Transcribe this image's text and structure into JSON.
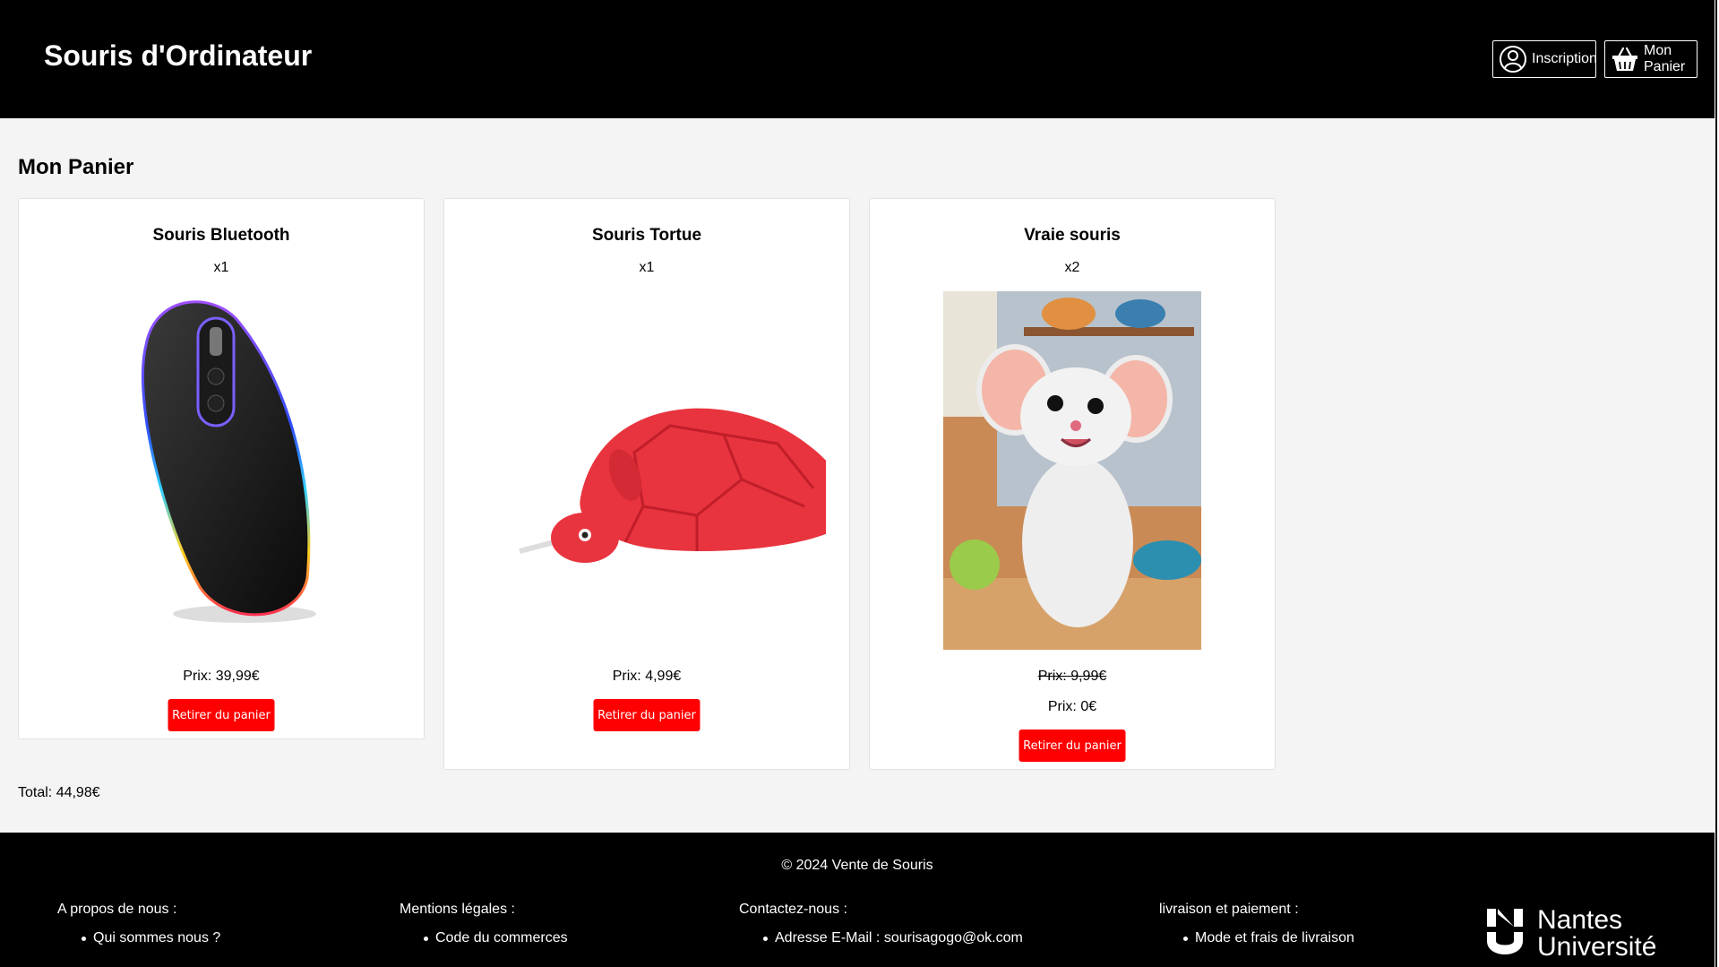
{
  "header": {
    "title": "Souris d'Ordinateur",
    "inscription_label": "Inscription",
    "panier_label": "Mon Panier"
  },
  "page": {
    "heading": "Mon Panier"
  },
  "cart_items": [
    {
      "name": "Souris Bluetooth",
      "qty": "x1",
      "price": "Prix: 39,99€",
      "remove_label": "Retirer du panier",
      "image": "bluetooth-mouse"
    },
    {
      "name": "Souris Tortue",
      "qty": "x1",
      "price": "Prix: 4,99€",
      "remove_label": "Retirer du panier",
      "image": "turtle-mouse"
    },
    {
      "name": "Vraie souris",
      "qty": "x2",
      "old_price": "Prix: 9,99€",
      "price": "Prix: 0€",
      "remove_label": "Retirer du panier",
      "image": "real-mouse"
    }
  ],
  "total": "Total: 44,98€",
  "footer": {
    "copyright": "© 2024 Vente de Souris",
    "columns": [
      {
        "title": "A propos de nous :",
        "items": [
          "Qui sommes nous ?"
        ]
      },
      {
        "title": "Mentions légales :",
        "items": [
          "Code du commerces"
        ]
      },
      {
        "title": "Contactez-nous :",
        "items": [
          "Adresse E-Mail : sourisagogo@ok.com"
        ]
      },
      {
        "title": "livraison et paiement :",
        "items": [
          "Mode et frais de livraison"
        ]
      }
    ],
    "logo_line1": "Nantes",
    "logo_line2": "Université"
  },
  "colors": {
    "header_bg": "#000000",
    "remove_button": "#ff0000",
    "page_bg": "#f4f4f4"
  }
}
